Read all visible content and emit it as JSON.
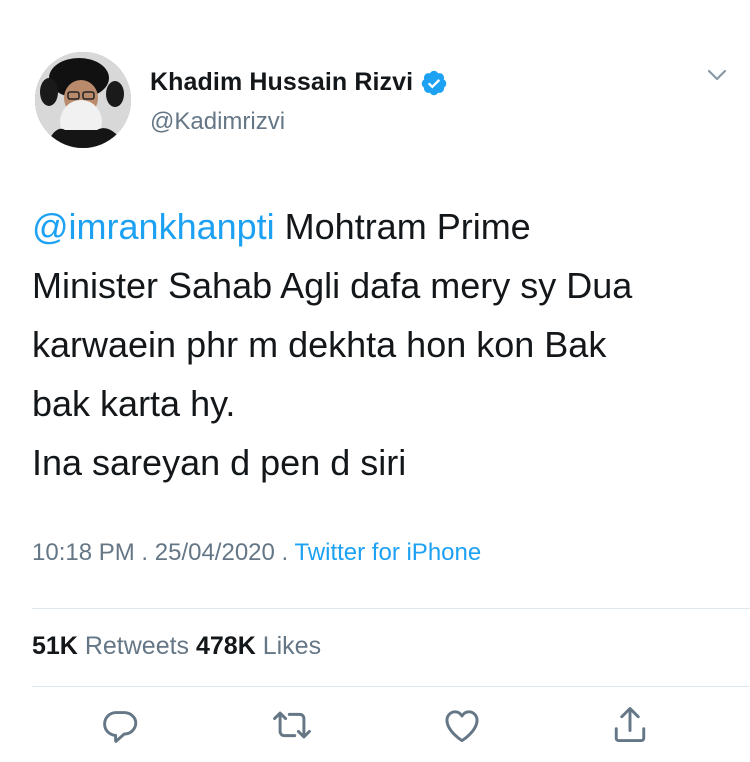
{
  "user": {
    "display_name": "Khadim Hussain Rizvi",
    "handle": "@Kadimrizvi",
    "verified_icon": "verified-badge-icon"
  },
  "tweet": {
    "mention": "@imrankhanpti",
    "text_line1_rest": " Mohtram Prime",
    "text_line2": "Minister Sahab Agli dafa mery sy Dua",
    "text_line3": "karwaein phr m dekhta hon kon Bak",
    "text_line4": "bak karta hy.",
    "text_line5": "Ina sareyan d pen d siri"
  },
  "meta": {
    "time": "10:18 PM",
    "sep1": " . ",
    "date": "25/04/2020",
    "sep2": " . ",
    "source": "Twitter for iPhone"
  },
  "stats": {
    "retweets_count": "51K",
    "retweets_label": "Retweets",
    "likes_count": "478K",
    "likes_label": "Likes"
  },
  "actions": [
    "reply-icon",
    "retweet-icon",
    "like-icon",
    "share-icon"
  ],
  "colors": {
    "accent": "#1da1f2",
    "secondary_text": "#657786",
    "primary_text": "#14171a",
    "divider": "#e1e8ed"
  }
}
